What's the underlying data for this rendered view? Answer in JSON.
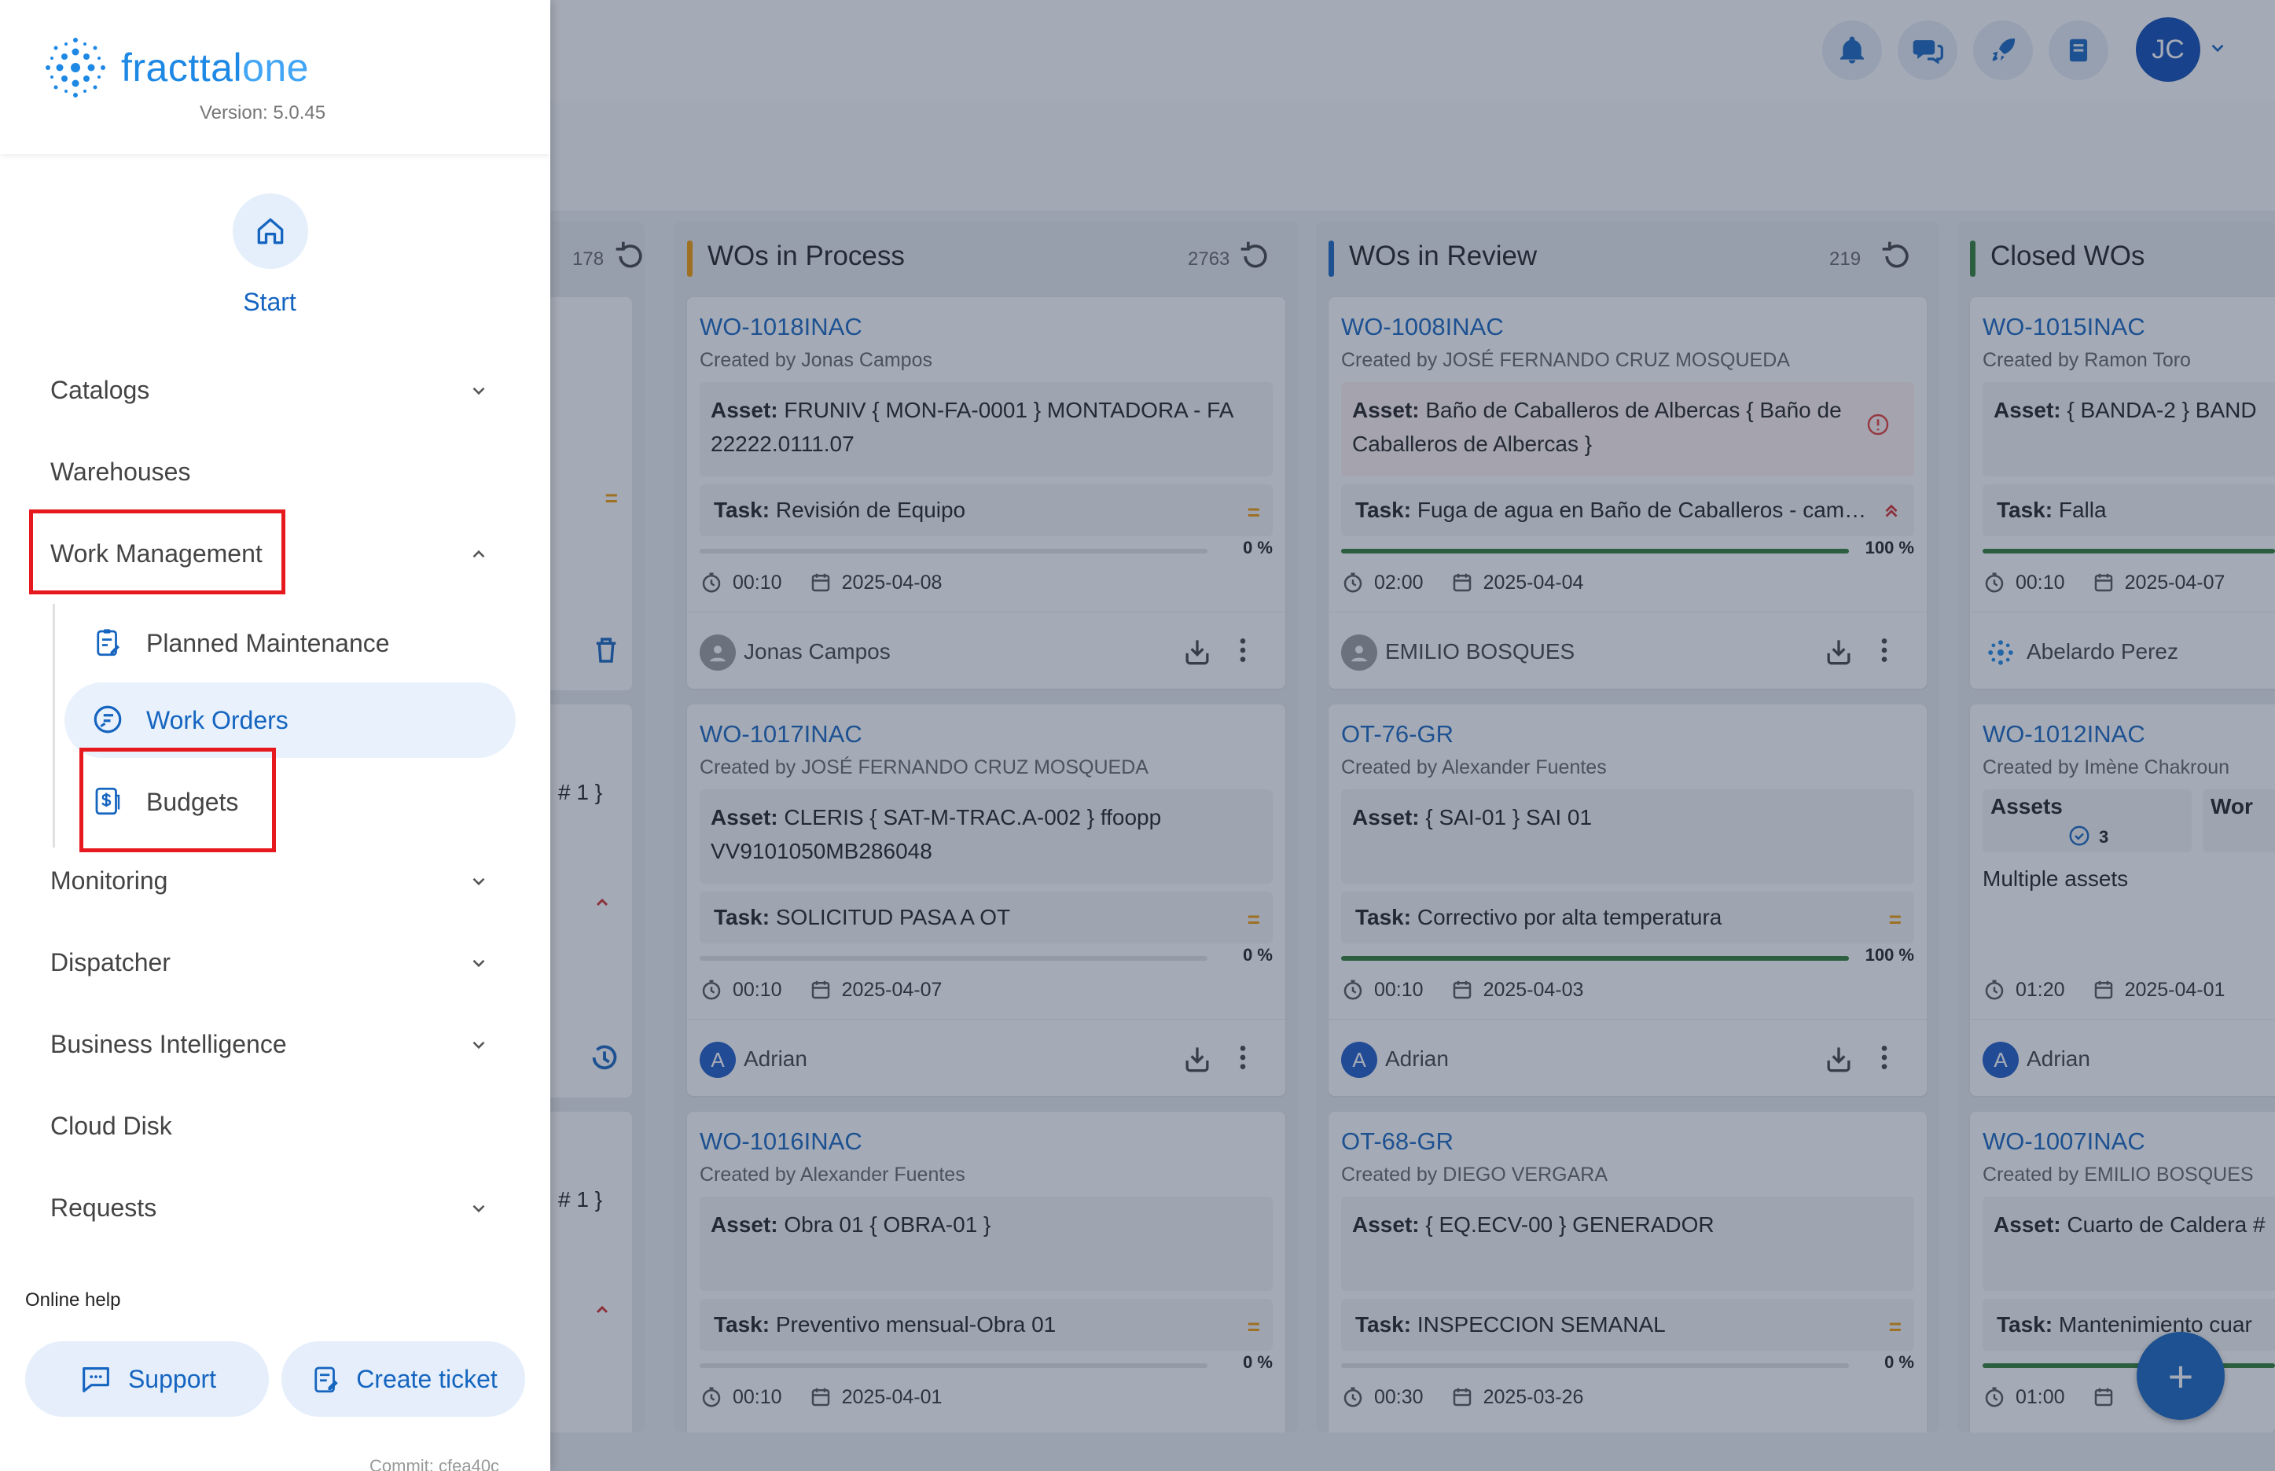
{
  "app": {
    "name_prefix": "fracttal",
    "name_suffix": "one",
    "version": "Version: 5.0.45",
    "user_initials": "JC"
  },
  "topbar_icons": [
    "bell-icon",
    "chat-icon",
    "rocket-icon",
    "book-icon"
  ],
  "sidebar": {
    "home_label": "Start",
    "items": [
      {
        "label": "Catalogs",
        "chevron": "down"
      },
      {
        "label": "Warehouses",
        "chevron": ""
      },
      {
        "label": "Work Management",
        "chevron": "up"
      },
      {
        "label": "Monitoring",
        "chevron": "down"
      },
      {
        "label": "Dispatcher",
        "chevron": "down"
      },
      {
        "label": "Business Intelligence",
        "chevron": "down"
      },
      {
        "label": "Cloud Disk",
        "chevron": ""
      },
      {
        "label": "Requests",
        "chevron": "down"
      }
    ],
    "sub_items": [
      {
        "label": "Planned Maintenance",
        "icon": "clipboard-edit-icon",
        "active": false
      },
      {
        "label": "Work Orders",
        "icon": "work-orders-icon",
        "active": true
      },
      {
        "label": "Budgets",
        "icon": "budget-dollar-icon",
        "active": false
      }
    ],
    "help_title": "Online help",
    "support_label": "Support",
    "ticket_label": "Create ticket",
    "commit": "Commit: cfea40c"
  },
  "partial_column": {
    "count": "178",
    "fragments": [
      "# 1 }",
      "# 1 }"
    ]
  },
  "columns": [
    {
      "title": "WOs in Process",
      "count": "2763",
      "color": "#f29900",
      "cards": [
        {
          "code": "WO-1018INAC",
          "created": "Created by Jonas Campos",
          "asset_label": "Asset:",
          "asset": "FRUNIV { MON-FA-0001 } MONTADORA - FA 22222.0111.07",
          "task_label": "Task:",
          "task": "Revisión de Equipo",
          "priority": "=",
          "progress": "0 %",
          "progress_value": 0,
          "time": "00:10",
          "date": "2025-04-08",
          "user": "Jonas Campos",
          "avatar": "person",
          "asset_error": false
        },
        {
          "code": "WO-1017INAC",
          "created": "Created by JOSÉ FERNANDO CRUZ MOSQUEDA",
          "asset_label": "Asset:",
          "asset": "CLERIS { SAT-M-TRAC.A-002 } ffoopp VV9101050MB286048",
          "task_label": "Task:",
          "task": "SOLICITUD PASA A OT",
          "priority": "=",
          "progress": "0 %",
          "progress_value": 0,
          "time": "00:10",
          "date": "2025-04-07",
          "user": "Adrian",
          "avatar": "A",
          "asset_error": false
        },
        {
          "code": "WO-1016INAC",
          "created": "Created by Alexander Fuentes",
          "asset_label": "Asset:",
          "asset": "Obra 01 { OBRA-01 }",
          "task_label": "Task:",
          "task": "Preventivo mensual-Obra 01",
          "priority": "=",
          "progress": "0 %",
          "progress_value": 0,
          "time": "00:10",
          "date": "2025-04-01",
          "user": "",
          "avatar": "",
          "asset_error": false
        }
      ]
    },
    {
      "title": "WOs in Review",
      "count": "219",
      "color": "#1565c0",
      "cards": [
        {
          "code": "WO-1008INAC",
          "created": "Created by JOSÉ FERNANDO CRUZ MOSQUEDA",
          "asset_label": "Asset:",
          "asset": "Baño de Caballeros de Albercas { Baño de Caballeros de Albercas }",
          "task_label": "Task:",
          "task": "Fuga de agua en Baño de Caballeros - cambi...",
          "priority": "high",
          "progress": "100 %",
          "progress_value": 100,
          "time": "02:00",
          "date": "2025-04-04",
          "user": "EMILIO BOSQUES",
          "avatar": "person",
          "asset_error": true
        },
        {
          "code": "OT-76-GR",
          "created": "Created by Alexander Fuentes",
          "asset_label": "Asset:",
          "asset": "{ SAI-01 } SAI 01",
          "task_label": "Task:",
          "task": "Correctivo por alta temperatura",
          "priority": "=",
          "progress": "100 %",
          "progress_value": 100,
          "time": "00:10",
          "date": "2025-04-03",
          "user": "Adrian",
          "avatar": "A",
          "asset_error": false
        },
        {
          "code": "OT-68-GR",
          "created": "Created by DIEGO VERGARA",
          "asset_label": "Asset:",
          "asset": "{ EQ.ECV-00 } GENERADOR",
          "task_label": "Task:",
          "task": "INSPECCION SEMANAL",
          "priority": "=",
          "progress": "0 %",
          "progress_value": 0,
          "time": "00:30",
          "date": "2025-03-26",
          "user": "",
          "avatar": "",
          "asset_error": false
        }
      ]
    },
    {
      "title": "Closed WOs",
      "count": "",
      "color": "#2e7d32",
      "cards": [
        {
          "code": "WO-1015INAC",
          "created": "Created by Ramon Toro",
          "asset_label": "Asset:",
          "asset": "{ BANDA-2 } BAND",
          "task_label": "Task:",
          "task": "Falla",
          "priority": "",
          "progress": "",
          "progress_value": 100,
          "time": "00:10",
          "date": "2025-04-07",
          "user": "Abelardo Perez",
          "avatar": "logo",
          "asset_error": false
        },
        {
          "code": "WO-1012INAC",
          "created": "Created by Imène Chakroun",
          "asset_label": "Assets",
          "asset": "3",
          "task_label": "Wor",
          "task": "Multiple assets",
          "priority": "",
          "progress": "",
          "progress_value": -1,
          "time": "01:20",
          "date": "2025-04-01",
          "user": "Adrian",
          "avatar": "A",
          "asset_error": false
        },
        {
          "code": "WO-1007INAC",
          "created": "Created by EMILIO BOSQUES",
          "asset_label": "Asset:",
          "asset": "Cuarto de Caldera #",
          "task_label": "Task:",
          "task": "Mantenimiento cuar",
          "priority": "",
          "progress": "",
          "progress_value": 100,
          "time": "01:00",
          "date": "",
          "user": "",
          "avatar": "",
          "asset_error": false
        }
      ]
    }
  ],
  "fab_label": "+"
}
